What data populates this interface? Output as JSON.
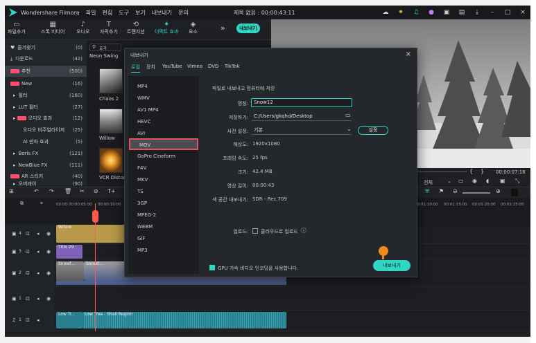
{
  "app": {
    "name": "Wondershare Filmora",
    "menu": [
      "파일",
      "편집",
      "도구",
      "보기",
      "내보내기",
      "문의"
    ],
    "window_title": "제목 없음 : 00:00:43:11"
  },
  "toolbar": {
    "tools": [
      {
        "label": "파일추가",
        "icon": "folder-icon"
      },
      {
        "label": "스톡 미디어",
        "icon": "stock-media-icon"
      },
      {
        "label": "오디오",
        "icon": "music-note-icon"
      },
      {
        "label": "자막추가",
        "icon": "text-icon"
      },
      {
        "label": "트랜지션",
        "icon": "transition-icon"
      },
      {
        "label": "이펙트 효과",
        "icon": "effects-icon",
        "active": true
      },
      {
        "label": "요소",
        "icon": "elements-icon"
      }
    ],
    "export_label": "내보내기"
  },
  "sidebar": {
    "items": [
      {
        "label": "즐겨찾기",
        "count": "(0)"
      },
      {
        "label": "다운로드",
        "count": "(42)"
      },
      {
        "label": "추천",
        "count": "(500)",
        "selected": true,
        "hot": true
      },
      {
        "label": "New",
        "count": "(16)",
        "hot": true
      },
      {
        "label": "필터",
        "count": "(160)"
      },
      {
        "label": "LUT 필터",
        "count": "(27)"
      },
      {
        "label": "오디오 효과",
        "count": "(12)",
        "hot": true
      },
      {
        "label": "오디오 비주얼라이저",
        "count": "(25)"
      },
      {
        "label": "AI 만화 효과",
        "count": "(5)"
      },
      {
        "label": "Boris FX",
        "count": "(121)"
      },
      {
        "label": "NewBlue FX",
        "count": "(111)"
      },
      {
        "label": "AR 스티커",
        "count": "(40)",
        "hot": true
      },
      {
        "label": "오버레이",
        "count": "(90)"
      }
    ]
  },
  "media": {
    "search_text": "효과",
    "thumbnails": [
      "Neon Swing",
      "Chaos 2",
      "Willow",
      "VCR Distort"
    ]
  },
  "preview": {
    "quality": "전체",
    "time": "00:00:07:16"
  },
  "timeline": {
    "ruler_marks": [
      "00:00",
      "00:00:05:00",
      "00:00:10:00",
      "00:01:10:00",
      "00:01:15:00",
      "00:01:20:00",
      "00:01:25:00"
    ],
    "tracks": [
      {
        "num": "4",
        "clips": [
          {
            "label": "Willow",
            "color": "#b99a4a"
          }
        ]
      },
      {
        "num": "3",
        "clips": [
          {
            "label": "Title 29",
            "color": "#7e62b5"
          }
        ]
      },
      {
        "num": "2",
        "clips": [
          {
            "label": "Snowf...",
            "color": "#4e5f8c"
          },
          {
            "label": "Snowf...",
            "color": "#4e5f8c"
          }
        ]
      },
      {
        "num": "1",
        "clips": []
      },
      {
        "num": "1",
        "clips": [
          {
            "label": "Low Tr...",
            "color": "#2a7f8e"
          },
          {
            "label": "Low Tree - Shail Region",
            "color": "#2a7f8e"
          }
        ]
      }
    ]
  },
  "dialog": {
    "title": "내보내기",
    "close": "×",
    "tabs": [
      "로컬",
      "장치",
      "YouTube",
      "Vimeo",
      "DVD",
      "TikTok"
    ],
    "active_tab": "로컬",
    "formats": [
      "MP4",
      "WMV",
      "AV1 MP4",
      "HEVC",
      "AVI",
      "MOV",
      "GoPro Cineform",
      "F4V",
      "MKV",
      "TS",
      "3GP",
      "MPEG-2",
      "WEBM",
      "GIF",
      "MP3"
    ],
    "selected_format": "MOV",
    "heading": "파일로 내보내고 컴퓨터에 저장",
    "fields": {
      "name_label": "명칭:",
      "name_value": "Snow12",
      "save_label": "저장하기:",
      "save_value": "C:/Users/gkqhd/Desktop",
      "preset_label": "사전 설정:",
      "preset_value": "기본",
      "settings_label": "설정",
      "resolution_label": "해상도:",
      "resolution_value": "1920x1080",
      "framerate_label": "프레임 속도:",
      "framerate_value": "25 fps",
      "size_label": "크기:",
      "size_value": "42.4 MB",
      "duration_label": "영상 길이:",
      "duration_value": "00:00:43",
      "colorspace_label": "색 공간 내보내기:",
      "colorspace_value": "SDR - Rec.709",
      "upload_label": "업로드:",
      "upload_option": "클라우드로 업로드",
      "gpu_label": "GPU 가속 비디오 인코딩을 사용합니다."
    },
    "export_button": "내보내기"
  },
  "colors": {
    "accent": "#2fd6c3",
    "highlight": "#e0555f",
    "pin": "#f28a1a"
  }
}
